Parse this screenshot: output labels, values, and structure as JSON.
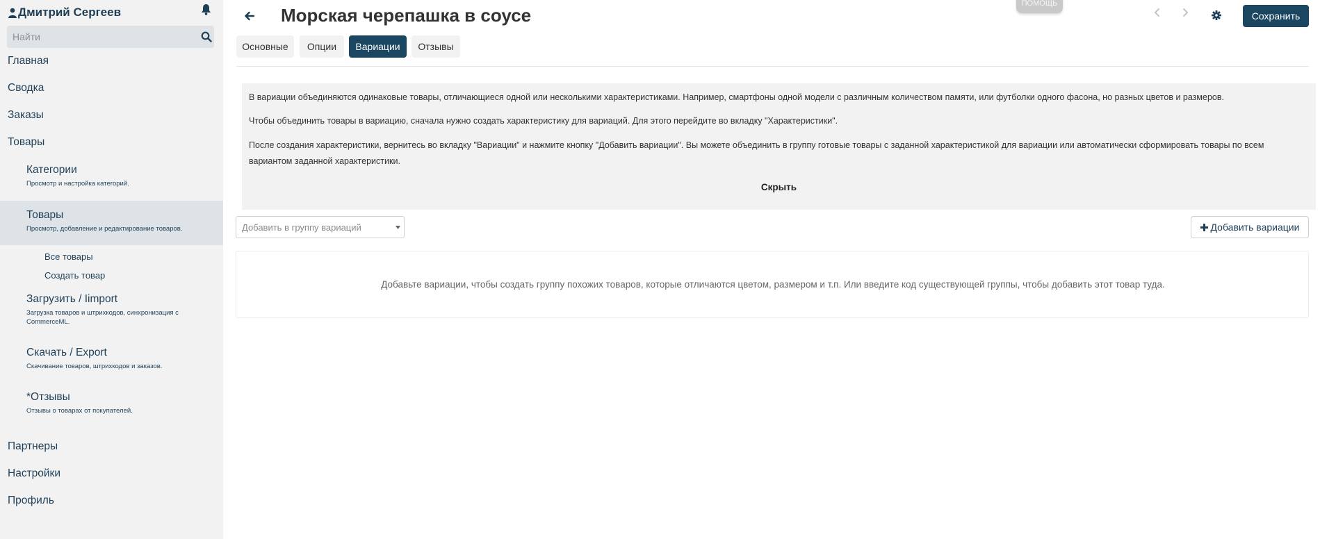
{
  "user": {
    "name": "Дмитрий Сергеев"
  },
  "search": {
    "placeholder": "Найти"
  },
  "sidebar": {
    "main": "Главная",
    "summary": "Сводка",
    "orders": "Заказы",
    "products": "Товары",
    "sub": [
      {
        "title": "Категории",
        "desc": "Просмотр и настройка категорий."
      },
      {
        "title": "Товары",
        "desc": "Просмотр, добавление и редактирование товаров."
      },
      {
        "title": "Загрузить / Iimport",
        "desc": "Загрузка товаров и штрихкодов, синхронизация с CommerceML."
      },
      {
        "title": "Скачать / Export",
        "desc": "Скачивание товаров, штрихкодов и заказов."
      },
      {
        "title": "*Отзывы",
        "desc": "Отзывы о товарах от покупателей."
      }
    ],
    "leaf_all": "Все товары",
    "leaf_create": "Создать товар",
    "partners": "Партнеры",
    "settings": "Настройки",
    "profile": "Профиль"
  },
  "header": {
    "title": "Морская черепашка в соусе",
    "help": "ПОМОЩЬ",
    "save": "Сохранить"
  },
  "tabs": [
    {
      "label": "Основные"
    },
    {
      "label": "Опции"
    },
    {
      "label": "Вариации"
    },
    {
      "label": "Отзывы"
    }
  ],
  "info": {
    "p1": "В вариации объединяются одинаковые товары, отличающиеся одной или несколькими характеристиками. Например, смартфоны одной модели с различным количеством памяти, или футболки одного фасона, но разных цветов и размеров.",
    "p2": "Чтобы объединить товары в вариацию, сначала нужно создать характеристику для вариаций. Для этого перейдите во вкладку \"Характеристики\".",
    "p3": "После создания характеристики, вернитесь во вкладку \"Вариации\" и нажмите кнопку \"Добавить вариации\". Вы можете объединить в группу готовые товары с заданной характеристикой для вариации или автоматически сформировать товары по всем вариантом заданной характеристики.",
    "hide": "Скрыть"
  },
  "variations": {
    "select_placeholder": "Добавить в группу вариаций",
    "add_button": "Добавить вариации",
    "empty": "Добавьте вариации, чтобы создать группу похожих товаров, которые отличаются цветом, размером и т.п. Или введите код существующей группы, чтобы добавить этот товар туда."
  },
  "colors": {
    "accent": "#1b4661",
    "sidebar_bg": "#f2f2f2",
    "sidebar_active": "#dde3e6"
  }
}
